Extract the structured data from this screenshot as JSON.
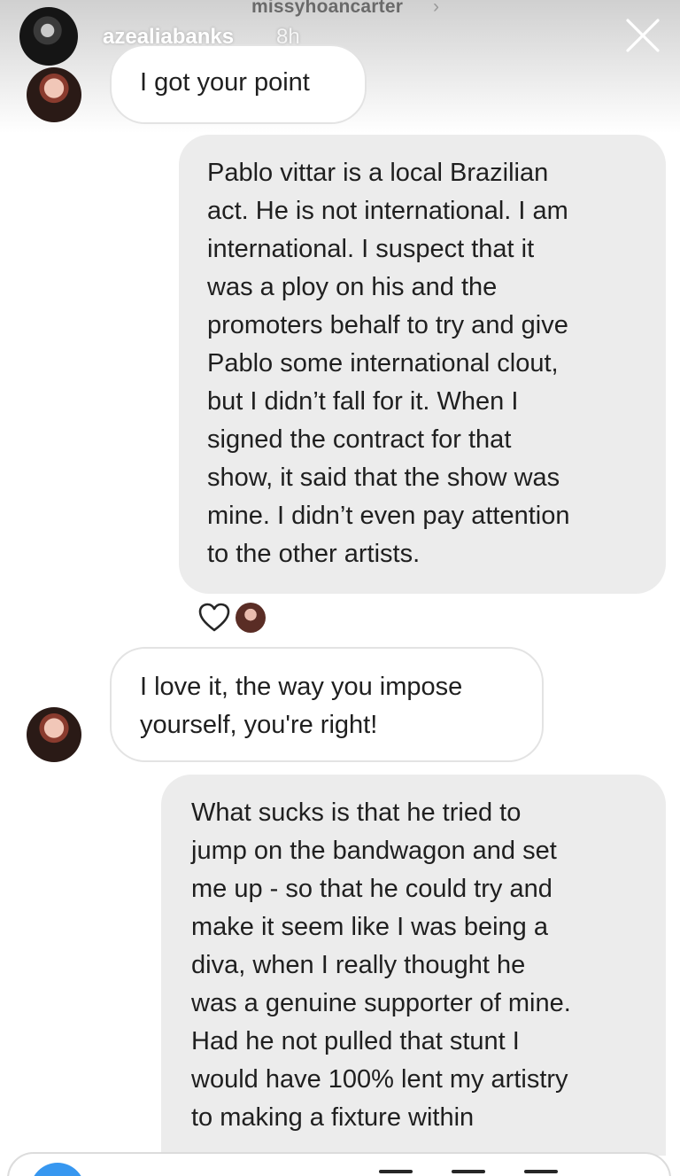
{
  "header": {
    "thread_username": "missyhoancarter",
    "chevron": "›",
    "story_poster": "azealiabanks",
    "story_time": "8h",
    "close_icon": "close-icon"
  },
  "messages": [
    {
      "direction": "incoming",
      "text": "I got your point"
    },
    {
      "direction": "outgoing",
      "text": "Pablo vittar is a local Brazilian\nact. He is not international. I am\ninternational. I suspect that it\nwas a ploy on his and the\npromoters behalf to try and give\nPablo some international clout,\nbut I didn’t fall for it. When I\nsigned the contract for that\nshow, it said that the show was\nmine. I didn’t even pay attention\nto the other artists."
    },
    {
      "direction": "incoming",
      "text": "I love it, the way you impose\nyourself, you're right!"
    },
    {
      "direction": "outgoing",
      "text": "What sucks is that he tried to\njump on the bandwagon and set\nme up - so that he could try and\nmake it seem like I was being a\ndiva, when I really thought he\nwas a genuine supporter of mine.\nHad he not pulled that stunt I\nwould have 100% lent my artistry\nto making a fixture within"
    }
  ],
  "reaction": {
    "icon": "heart-outline-icon"
  },
  "colors": {
    "incoming_bubble_border": "#e3e3e3",
    "outgoing_bubble": "#ececec",
    "camera_button": "#3797f0",
    "text": "#1f1f1f"
  }
}
